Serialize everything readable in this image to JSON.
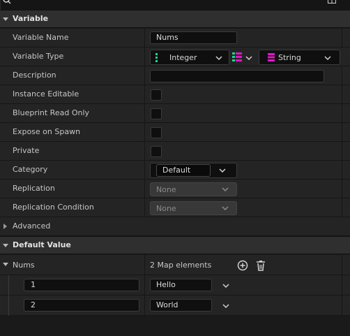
{
  "sections": {
    "variable": "Variable",
    "default_value": "Default Value"
  },
  "properties": {
    "variable_name": {
      "label": "Variable Name",
      "value": "Nums"
    },
    "variable_type": {
      "label": "Variable Type",
      "key_type": "Integer",
      "value_type": "String"
    },
    "description": {
      "label": "Description",
      "value": ""
    },
    "instance_editable": {
      "label": "Instance Editable",
      "checked": false
    },
    "blueprint_read_only": {
      "label": "Blueprint Read Only",
      "checked": false
    },
    "expose_on_spawn": {
      "label": "Expose on Spawn",
      "checked": false
    },
    "private": {
      "label": "Private",
      "checked": false
    },
    "category": {
      "label": "Category",
      "value": "Default"
    },
    "replication": {
      "label": "Replication",
      "value": "None"
    },
    "replication_condition": {
      "label": "Replication Condition",
      "value": "None"
    },
    "advanced": {
      "label": "Advanced"
    }
  },
  "default_value": {
    "label": "Nums",
    "summary": "2 Map elements",
    "elements": [
      {
        "key": "1",
        "value": "Hello"
      },
      {
        "key": "2",
        "value": "World"
      }
    ]
  },
  "colors": {
    "integer_pin": "#20d38f",
    "string_pin": "#e015c8",
    "panel_bg": "#242424",
    "header_bg": "#2f2f2f"
  }
}
